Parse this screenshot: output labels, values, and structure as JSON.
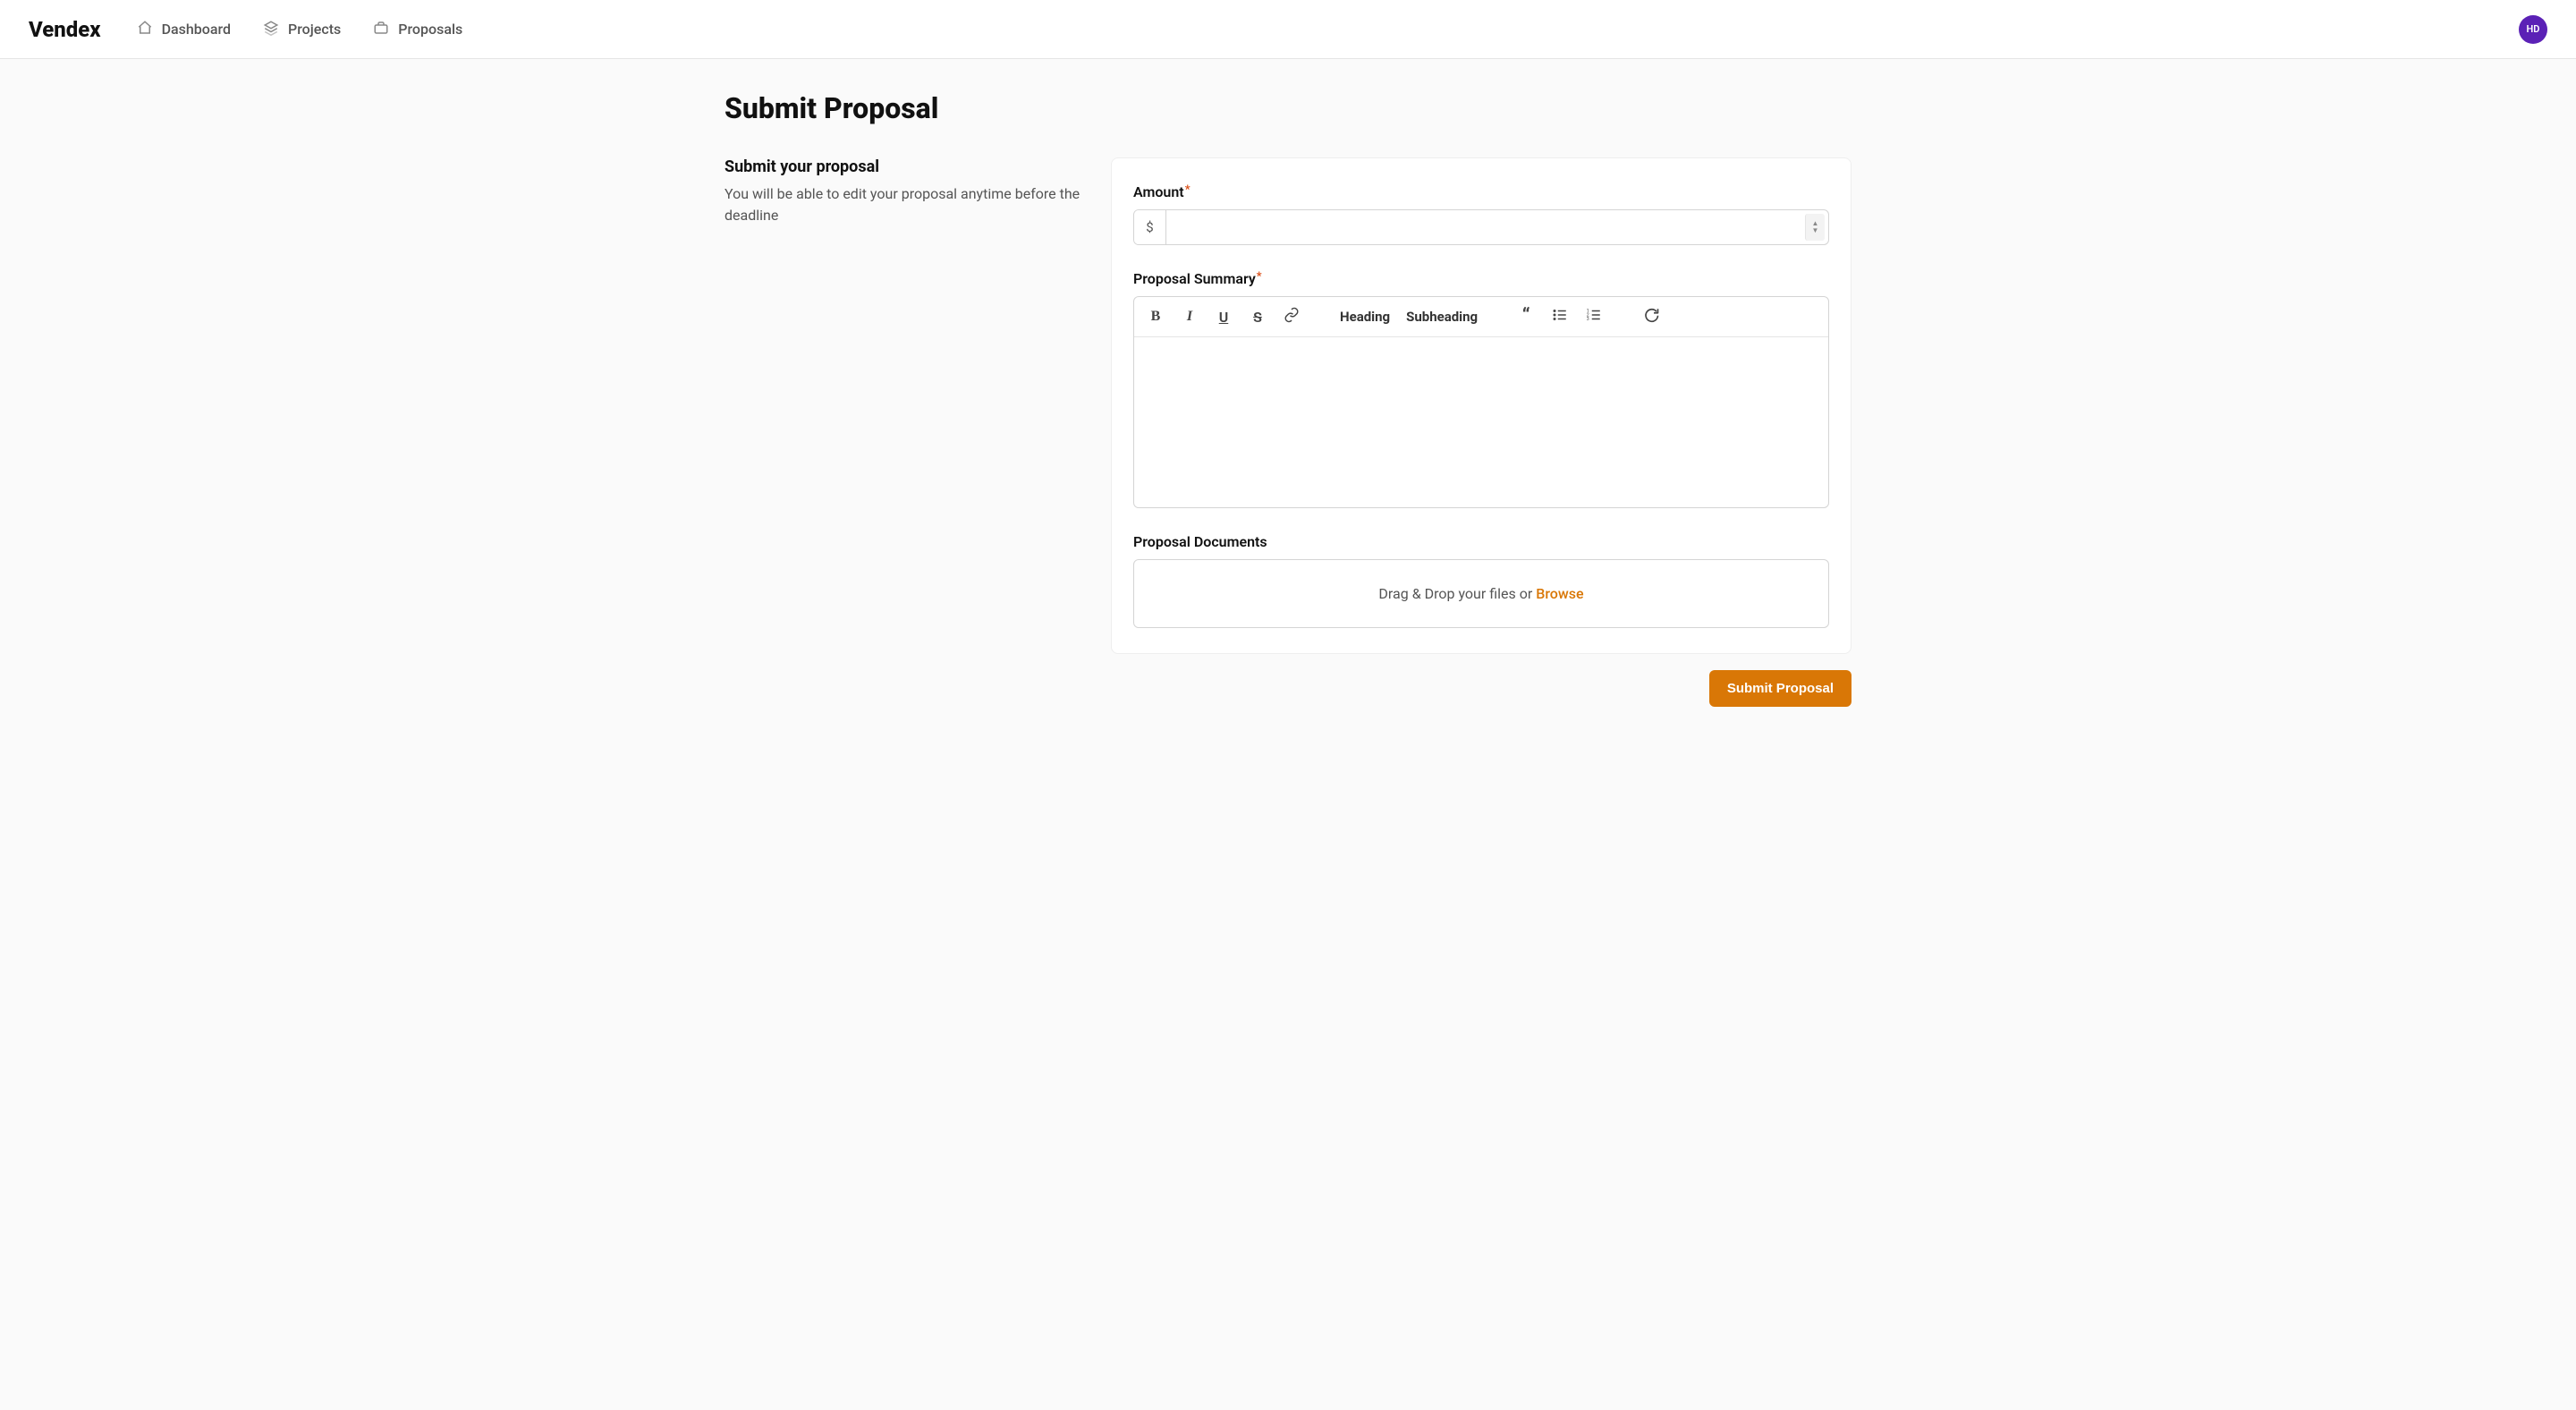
{
  "brand": "Vendex",
  "nav": {
    "items": [
      {
        "label": "Dashboard"
      },
      {
        "label": "Projects"
      },
      {
        "label": "Proposals"
      }
    ]
  },
  "avatar": {
    "initials": "HD"
  },
  "page": {
    "title": "Submit Proposal",
    "subheading": "Submit your proposal",
    "subdesc": "You will be able to edit your proposal anytime before the deadline"
  },
  "form": {
    "amount": {
      "label": "Amount",
      "required_mark": "*",
      "currency_symbol": "$",
      "value": ""
    },
    "summary": {
      "label": "Proposal Summary",
      "required_mark": "*",
      "value": ""
    },
    "toolbar": {
      "heading": "Heading",
      "subheading": "Subheading"
    },
    "documents": {
      "label": "Proposal Documents",
      "dropzone_text": "Drag & Drop your files or ",
      "browse": "Browse"
    },
    "submit_label": "Submit Proposal"
  }
}
